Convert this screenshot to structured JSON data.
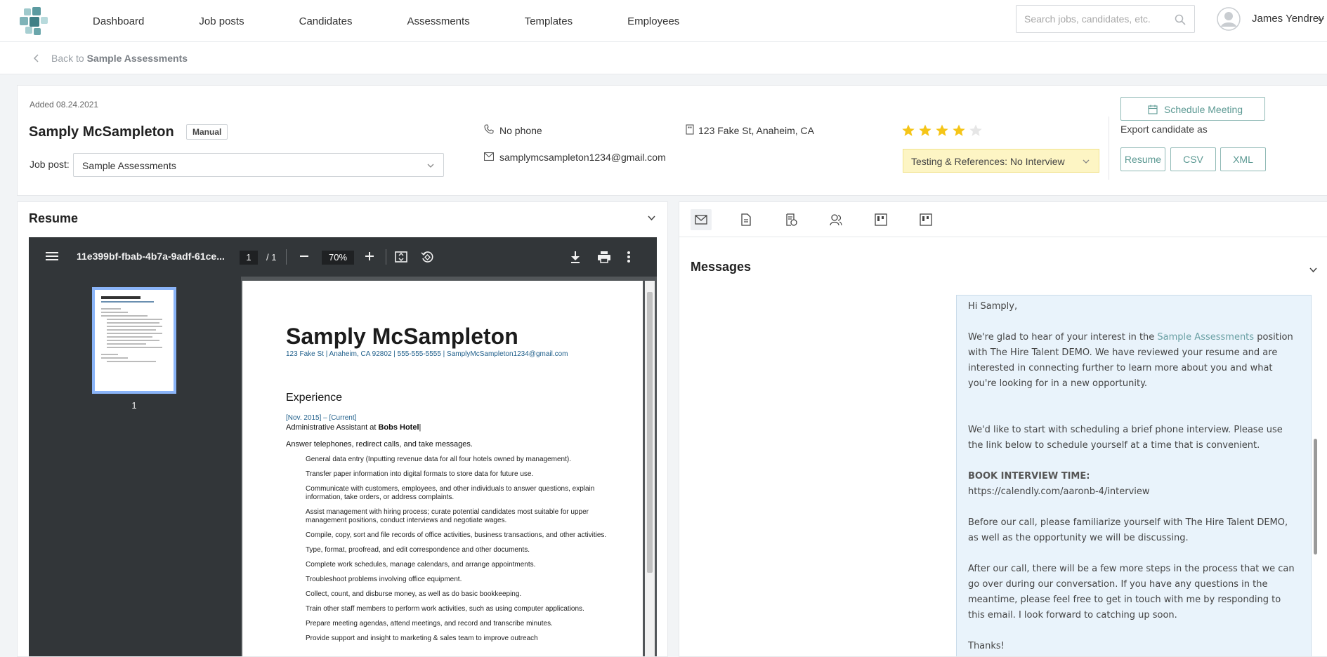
{
  "nav": {
    "items": [
      "Dashboard",
      "Job posts",
      "Candidates",
      "Assessments",
      "Templates",
      "Employees"
    ],
    "search_placeholder": "Search jobs, candidates, etc.",
    "user_name": "James Yendrey"
  },
  "back": {
    "prefix": "Back to",
    "target": "Sample Assessments"
  },
  "candidate": {
    "added": "Added 08.24.2021",
    "name": "Samply McSampleton",
    "badge": "Manual",
    "job_post_label": "Job post:",
    "job_post_value": "Sample Assessments",
    "phone": "No phone",
    "email": "samplymcsampleton1234@gmail.com",
    "address": "123 Fake St, Anaheim, CA",
    "rating": 4,
    "rating_max": 5,
    "stage": "Testing & References: No Interview",
    "schedule_label": "Schedule Meeting",
    "export_label": "Export candidate as",
    "export_options": [
      "Resume",
      "CSV",
      "XML"
    ]
  },
  "resume": {
    "title": "Resume",
    "viewer": {
      "filename": "11e399bf-fbab-4b7a-9adf-61ce...",
      "page": "1",
      "page_count": "/ 1",
      "zoom": "70%",
      "thumb_label": "1"
    },
    "document": {
      "name": "Samply McSampleton",
      "contact": "123 Fake St | Anaheim, CA 92802 | 555-555-5555 | SamplyMcSampleton1234@gmail.com",
      "section": "Experience",
      "dates": "[Nov. 2015] – [Current]",
      "role_prefix": "Administrative Assistant at",
      "employer": "Bobs Hotel",
      "role_suffix": "|",
      "summary": "Answer telephones, redirect calls, and take messages.",
      "bullets": [
        "General data entry (Inputting revenue data for all four hotels owned by management).",
        "Transfer paper information into digital formats to store data for future use.",
        "Communicate with customers, employees, and other individuals to answer questions, explain information, take orders, or address complaints.",
        "Assist management with hiring process; curate potential candidates most suitable for upper management positions, conduct interviews and negotiate wages.",
        "Compile, copy, sort and file records of office activities, business transactions, and other activities.",
        "Type, format, proofread, and edit correspondence and other documents.",
        "Complete work schedules, manage calendars, and arrange appointments.",
        "Troubleshoot problems involving office equipment.",
        "Collect, count, and disburse money, as well as do basic bookkeeping.",
        "Train other staff members to perform work activities, such as using computer applications.",
        "Prepare meeting agendas, attend meetings, and record and transcribe minutes.",
        "Provide support and insight to marketing & sales team to improve outreach"
      ]
    }
  },
  "messages": {
    "title": "Messages",
    "email": {
      "greeting": "Hi Samply,",
      "p1_before": "We're glad to hear of your interest in the ",
      "p1_link": "Sample Assessments",
      "p1_after": " position with The Hire Talent DEMO. We have reviewed your resume and are interested in connecting further to learn more about you and what you're looking for in a new opportunity.",
      "p2": "We'd like to start with scheduling a brief phone interview. Please use the link below to schedule yourself at a time that is convenient.",
      "book_label": "BOOK INTERVIEW TIME:",
      "book_url": "https://calendly.com/aaronb-4/interview",
      "p3": "Before our call, please familiarize yourself with The Hire Talent DEMO, as well as the opportunity we will be discussing.",
      "p4": "After our call, there will be a few more steps in the process that we can go over during our conversation. If you have any questions in the meantime, please feel free to get in touch with me by responding to this email. I look forward to catching up soon.",
      "signoff": "Thanks!"
    }
  },
  "colors": {
    "accent": "#5c9993",
    "star": "#f5c518",
    "stage_bg": "#fdf5c4",
    "message_bg": "#e9f3fb"
  }
}
